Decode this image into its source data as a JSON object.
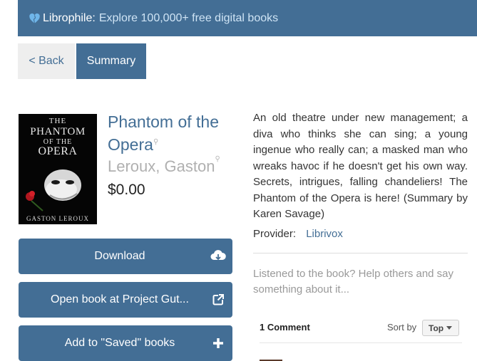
{
  "header": {
    "brand": "Librophile:",
    "tagline": "Explore 100,000+ free digital books"
  },
  "nav": {
    "back_label": "< Back",
    "summary_label": "Summary"
  },
  "book": {
    "cover": {
      "line1": "THE",
      "line2": "PHANTOM",
      "line3": "OF THE",
      "line4": "OPERA",
      "author": "GASTON LEROUX"
    },
    "title": "Phantom of the Opera",
    "author": "Leroux, Gaston",
    "price": "$0.00",
    "summary": "An old theatre under new management; a diva who thinks she can sing; a young ingenue who really can; a masked man who wreaks havoc if he doesn't get his own way. Secrets, intrigues, falling chandeliers! The Phantom of the Opera is here! (Summary by Karen Savage)",
    "provider_label": "Provider:",
    "provider": "Librivox"
  },
  "actions": {
    "download": "Download",
    "open_book": "Open book at Project Gut...",
    "add_saved": "Add to \"Saved\" books"
  },
  "comments": {
    "prompt": "Listened to the book? Help others and say something about it...",
    "count_label": "1 Comment",
    "sort_label": "Sort by",
    "sort_value": "Top"
  },
  "colors": {
    "accent": "#436e95",
    "header_bg": "#436e95",
    "heart": "#6fb6ea"
  },
  "icons": {
    "brand": "heart-icon",
    "download": "cloud-download-icon",
    "open": "external-link-icon",
    "add": "plus-icon",
    "search": "magnifier-icon",
    "sort": "caret-down-icon"
  }
}
